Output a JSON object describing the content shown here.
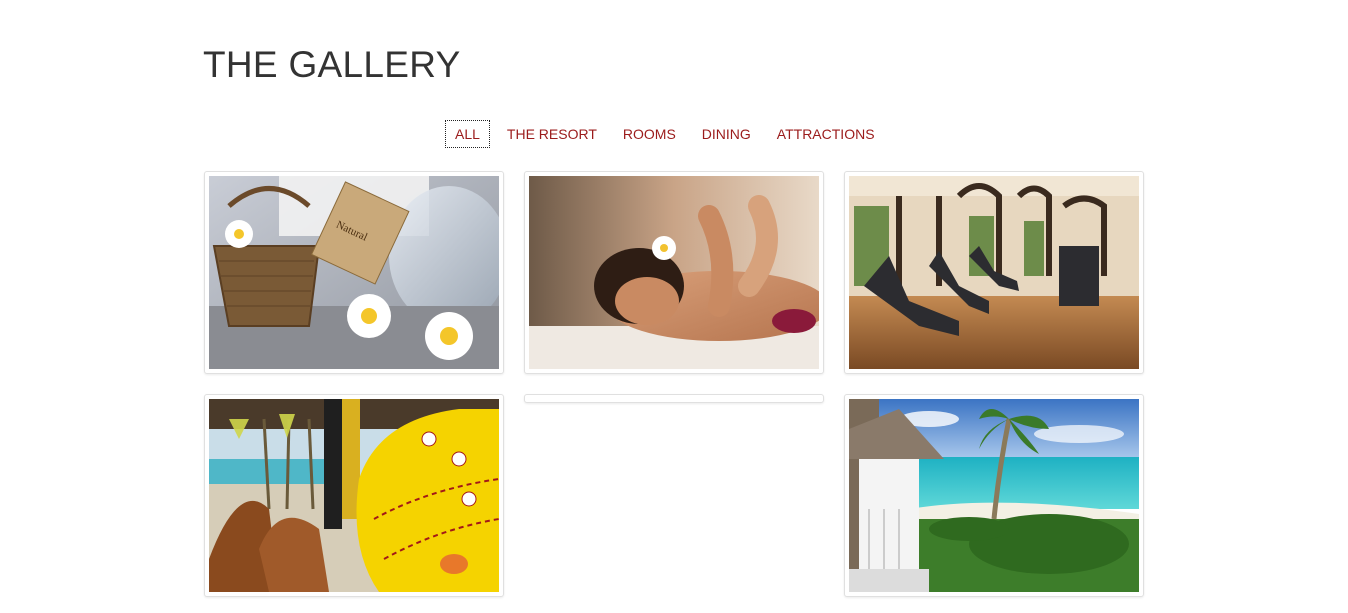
{
  "page": {
    "title": "THE GALLERY"
  },
  "filters": [
    {
      "label": "ALL",
      "active": true
    },
    {
      "label": "THE RESORT",
      "active": false
    },
    {
      "label": "ROOMS",
      "active": false
    },
    {
      "label": "DINING",
      "active": false
    },
    {
      "label": "ATTRACTIONS",
      "active": false
    }
  ],
  "gallery": {
    "items": [
      {
        "subject": "spa-products-photo",
        "tag_text": "Natural"
      },
      {
        "subject": "massage-photo"
      },
      {
        "subject": "fitness-center-photo"
      },
      {
        "subject": "beach-watersports-photo"
      },
      {
        "subject": "empty-thumbnail"
      },
      {
        "subject": "beach-gazebo-photo"
      }
    ]
  },
  "colors": {
    "title": "#333333",
    "filter_link": "#9b1b1b",
    "card_border": "#e0e0e0",
    "background": "#ffffff"
  }
}
